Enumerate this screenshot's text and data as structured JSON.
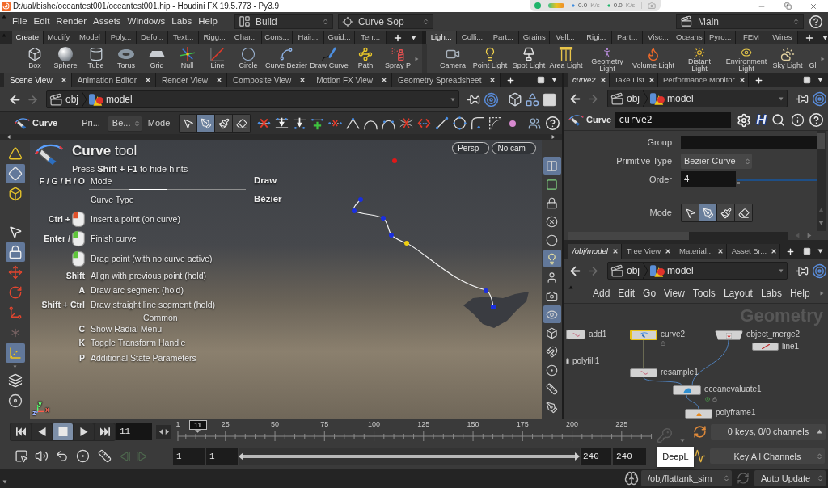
{
  "title_bar": {
    "title": "D:/ual/bishe/oceantest001/oceantest001.hip - Houdini FX 19.5.773 - Py3.9"
  },
  "net_monitor": {
    "readings": [
      {
        "value": "0.0",
        "unit": "K/s"
      },
      {
        "value": "0.0",
        "unit": "K/s"
      }
    ]
  },
  "menu_bar": {
    "items": [
      "File",
      "Edit",
      "Render",
      "Assets",
      "Windows",
      "Labs",
      "Help"
    ],
    "desktop": "Build",
    "tool": "Curve Sop",
    "context": "Main"
  },
  "shelves": [
    {
      "tabs": [
        {
          "label": "Create",
          "selected": true
        },
        {
          "label": "Modify",
          "selected": false
        },
        {
          "label": "Model",
          "selected": false
        },
        {
          "label": "Poly...",
          "selected": false
        },
        {
          "label": "Defo...",
          "selected": false
        },
        {
          "label": "Text...",
          "selected": false
        },
        {
          "label": "Rigg...",
          "selected": false
        },
        {
          "label": "Char...",
          "selected": false
        },
        {
          "label": "Cons...",
          "selected": false
        },
        {
          "label": "Hair...",
          "selected": false
        },
        {
          "label": "Guid...",
          "selected": false
        },
        {
          "label": "Terr...",
          "selected": false
        }
      ],
      "tools": [
        "Box",
        "Sphere",
        "Tube",
        "Torus",
        "Grid",
        "Null",
        "Line",
        "Circle",
        "Curve Bezier",
        "Draw Curve",
        "Path",
        "Spray P"
      ]
    },
    {
      "tabs": [
        {
          "label": "Ligh...",
          "selected": true
        },
        {
          "label": "Colli...",
          "selected": false
        },
        {
          "label": "Part...",
          "selected": false
        },
        {
          "label": "Grains",
          "selected": false
        },
        {
          "label": "Vell...",
          "selected": false
        },
        {
          "label": "Rigi...",
          "selected": false
        },
        {
          "label": "Part...",
          "selected": false
        },
        {
          "label": "Visc...",
          "selected": false
        },
        {
          "label": "Oceans",
          "selected": false
        },
        {
          "label": "Pyro...",
          "selected": false
        },
        {
          "label": "FEM",
          "selected": false
        },
        {
          "label": "Wires",
          "selected": false
        }
      ],
      "tools": [
        "Camera",
        "Point Light",
        "Spot Light",
        "Area Light",
        "Geometry Light",
        "Volume Light",
        "Distant Light",
        "Environment Light",
        "Sky Light",
        "Gl"
      ]
    }
  ],
  "scene_pane": {
    "tabs": [
      {
        "label": "Scene View",
        "selected": true
      },
      {
        "label": "Animation Editor",
        "selected": false
      },
      {
        "label": "Render View",
        "selected": false
      },
      {
        "label": "Composite View",
        "selected": false
      },
      {
        "label": "Motion FX View",
        "selected": false
      },
      {
        "label": "Geometry Spreadsheet",
        "selected": false
      }
    ],
    "path": [
      "obj",
      "model"
    ],
    "tool_options": {
      "tool": "Curve",
      "primitive_label": "Pri...",
      "primitive_value": "Be...",
      "mode_label": "Mode",
      "modes": [
        {
          "selected": false
        },
        {
          "selected": true
        },
        {
          "selected": false
        },
        {
          "selected": false
        }
      ]
    },
    "left_toolbar": [
      {
        "selected": false
      },
      {
        "selected": true
      },
      {
        "selected": false
      },
      {
        "selected": false
      },
      {
        "selected": true
      },
      {
        "selected": false
      },
      {
        "selected": false
      },
      {
        "selected": false
      },
      {
        "selected": false
      },
      {
        "selected": true
      },
      {
        "selected": false
      },
      {
        "selected": false
      }
    ],
    "right_toolbar": [
      {
        "selected": true
      },
      {
        "selected": false
      },
      {
        "selected": false
      },
      {
        "selected": false
      },
      {
        "selected": false
      },
      {
        "selected": true
      },
      {
        "selected": false
      },
      {
        "selected": false
      },
      {
        "selected": true
      },
      {
        "selected": false
      },
      {
        "selected": false
      },
      {
        "selected": false
      },
      {
        "selected": false
      },
      {
        "selected": false
      }
    ],
    "viewport": {
      "camera_buttons": [
        "Persp -",
        "No cam -"
      ],
      "hints": {
        "title": "**Curve** tool",
        "subtitle": "Press **Shift + F1** to hide hints",
        "rows": [
          {
            "kind": "setting",
            "keys": "F / G / H / O",
            "label": "Mode",
            "value": "Draw"
          },
          {
            "kind": "setting",
            "label": "Curve Type",
            "value": "Bézier"
          },
          {
            "kind": "mouse",
            "keys": "Ctrl +",
            "color": "#e0502a",
            "label": "Insert a point (on curve)"
          },
          {
            "kind": "mouse",
            "keys": "Enter /",
            "color": "#5ec43a",
            "label": "Finish curve"
          },
          {
            "kind": "mouse",
            "color": "#5ec43a",
            "label": "Drag point (with no curve active)"
          },
          {
            "kind": "key",
            "keys": "Shift",
            "label": "Align with previous point (hold)"
          },
          {
            "kind": "key",
            "keys": "A",
            "label": "Draw arc segment (hold)"
          },
          {
            "kind": "key",
            "keys": "Shift + Ctrl",
            "label": "Draw straight line segment (hold)"
          },
          {
            "kind": "section",
            "label": "Common"
          },
          {
            "kind": "key",
            "keys": "C",
            "label": "Show Radial Menu"
          },
          {
            "kind": "key",
            "keys": "K",
            "label": "Toggle Transform Handle"
          },
          {
            "kind": "key",
            "keys": "P",
            "label": "Additional State Parameters"
          }
        ]
      },
      "axis_labels": [
        "y",
        "x",
        "z"
      ]
    }
  },
  "parm_pane": {
    "tabs": [
      {
        "label": "curve2",
        "selected": true,
        "italic": true
      },
      {
        "label": "Take List",
        "selected": false,
        "italic": false
      },
      {
        "label": "Performance Monitor",
        "selected": false,
        "italic": false
      }
    ],
    "path": [
      "obj",
      "model"
    ],
    "node_type": "Curve",
    "node_name": "curve2",
    "help_badge": "H",
    "parms": [
      {
        "kind": "field",
        "label": "Group"
      },
      {
        "kind": "menu",
        "label": "Primitive Type",
        "value": "Bezier Curve"
      },
      {
        "kind": "slider",
        "label": "Order",
        "value": "4",
        "level": 0
      },
      {
        "kind": "modes",
        "label": "Mode",
        "modes": [
          {
            "selected": false
          },
          {
            "selected": true
          },
          {
            "selected": false
          },
          {
            "selected": false
          }
        ]
      }
    ]
  },
  "network_pane": {
    "tabs": [
      {
        "label": "/obj/model",
        "selected": true,
        "italic": true
      },
      {
        "label": "Tree View",
        "selected": false,
        "italic": false
      },
      {
        "label": "Material...",
        "selected": false,
        "italic": false
      },
      {
        "label": "Asset Br...",
        "selected": false,
        "italic": false
      }
    ],
    "path": [
      "obj",
      "model"
    ],
    "menu": [
      "Add",
      "Edit",
      "Go",
      "View",
      "Tools",
      "Layout",
      "Labs",
      "Help"
    ],
    "context_label": "Geometry",
    "nodes": [
      {
        "name": "add1",
        "selected": false
      },
      {
        "name": "curve2",
        "selected": true
      },
      {
        "name": "object_merge2",
        "selected": false
      },
      {
        "name": "line1",
        "selected": false
      },
      {
        "name": "polyfill1",
        "selected": false
      },
      {
        "name": "resample1",
        "selected": false
      },
      {
        "name": "oceanevaluate1",
        "selected": false
      },
      {
        "name": "polyframe1",
        "selected": false
      }
    ]
  },
  "playbar": {
    "transport": [
      {
        "selected": false
      },
      {
        "selected": false
      },
      {
        "selected": true
      },
      {
        "selected": false
      },
      {
        "selected": false
      }
    ],
    "frame": "11",
    "ruler_labels": [
      "1",
      "25",
      "50",
      "75",
      "100",
      "125",
      "150",
      "175",
      "200",
      "225"
    ],
    "playhead": {
      "label": "11",
      "level": 0.042
    },
    "range_fields": [
      "1",
      "1",
      "240",
      "240"
    ],
    "range": {
      "level": 1
    },
    "keys_info": "0 keys, 0/0 channels",
    "key_all": "Key All Channels"
  },
  "tooltip": "DeepL",
  "status_bar": {
    "sim_path": "/obj/flattank_sim",
    "update_mode": "Auto Update"
  }
}
